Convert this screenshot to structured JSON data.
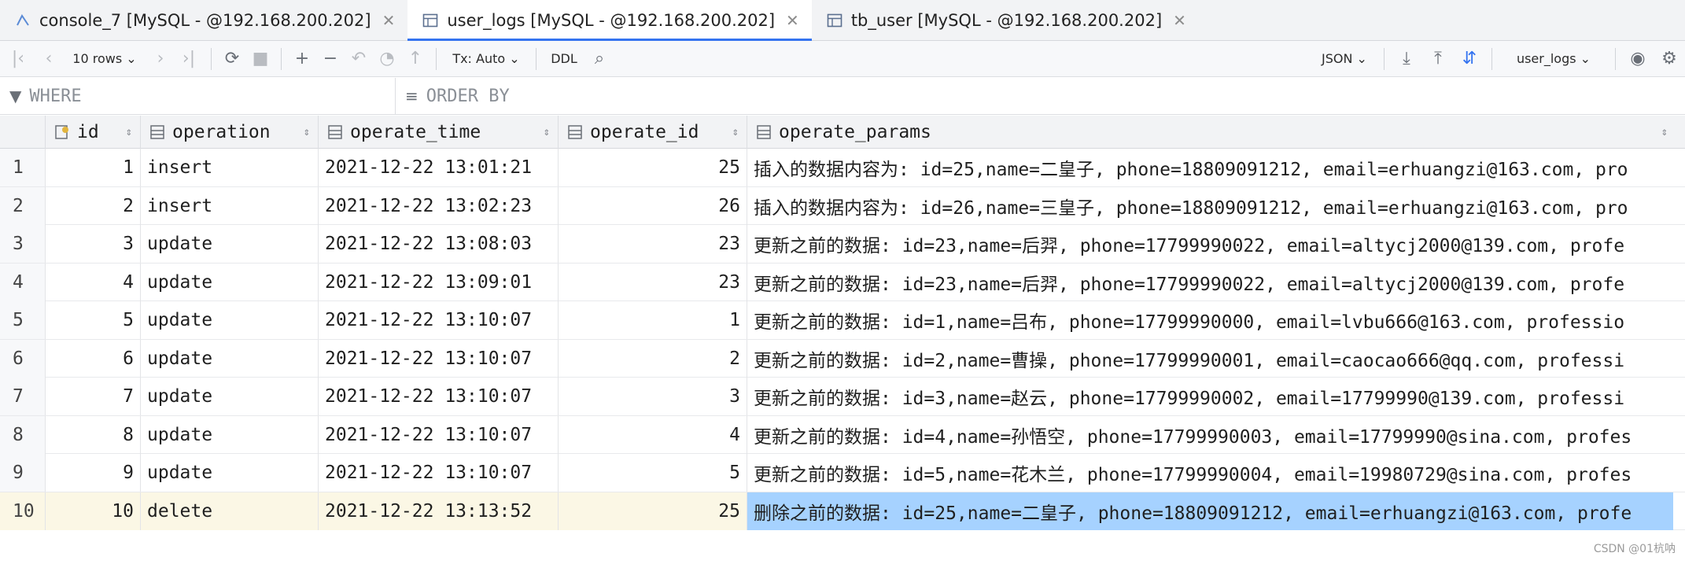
{
  "tabs": [
    {
      "label": "console_7 [MySQL - @192.168.200.202]",
      "icon": "console-icon",
      "active": false
    },
    {
      "label": "user_logs [MySQL - @192.168.200.202]",
      "icon": "table-icon",
      "active": true
    },
    {
      "label": "tb_user [MySQL - @192.168.200.202]",
      "icon": "table-icon",
      "active": false
    }
  ],
  "toolbar": {
    "rows_label": "10 rows",
    "tx_label": "Tx: Auto",
    "ddl_label": "DDL",
    "format_label": "JSON",
    "table_select": "user_logs"
  },
  "filter": {
    "where_placeholder": "WHERE",
    "orderby_placeholder": "ORDER BY"
  },
  "columns": [
    "id",
    "operation",
    "operate_time",
    "operate_id",
    "operate_params"
  ],
  "rows": [
    {
      "num": "1",
      "id": "1",
      "operation": "insert",
      "time": "2021-12-22 13:01:21",
      "opid": "25",
      "params": "插入的数据内容为: id=25,name=二皇子, phone=18809091212, email=erhuangzi@163.com, pro"
    },
    {
      "num": "2",
      "id": "2",
      "operation": "insert",
      "time": "2021-12-22 13:02:23",
      "opid": "26",
      "params": "插入的数据内容为: id=26,name=三皇子, phone=18809091212, email=erhuangzi@163.com, pro"
    },
    {
      "num": "3",
      "id": "3",
      "operation": "update",
      "time": "2021-12-22 13:08:03",
      "opid": "23",
      "params": "更新之前的数据: id=23,name=后羿, phone=17799990022, email=altycj2000@139.com, profe"
    },
    {
      "num": "4",
      "id": "4",
      "operation": "update",
      "time": "2021-12-22 13:09:01",
      "opid": "23",
      "params": "更新之前的数据: id=23,name=后羿, phone=17799990022, email=altycj2000@139.com, profe"
    },
    {
      "num": "5",
      "id": "5",
      "operation": "update",
      "time": "2021-12-22 13:10:07",
      "opid": "1",
      "params": "更新之前的数据: id=1,name=吕布, phone=17799990000, email=lvbu666@163.com, professio"
    },
    {
      "num": "6",
      "id": "6",
      "operation": "update",
      "time": "2021-12-22 13:10:07",
      "opid": "2",
      "params": "更新之前的数据: id=2,name=曹操, phone=17799990001, email=caocao666@qq.com, professi"
    },
    {
      "num": "7",
      "id": "7",
      "operation": "update",
      "time": "2021-12-22 13:10:07",
      "opid": "3",
      "params": "更新之前的数据: id=3,name=赵云, phone=17799990002, email=17799990@139.com, professi"
    },
    {
      "num": "8",
      "id": "8",
      "operation": "update",
      "time": "2021-12-22 13:10:07",
      "opid": "4",
      "params": "更新之前的数据: id=4,name=孙悟空, phone=17799990003, email=17799990@sina.com, profes"
    },
    {
      "num": "9",
      "id": "9",
      "operation": "update",
      "time": "2021-12-22 13:10:07",
      "opid": "5",
      "params": "更新之前的数据: id=5,name=花木兰, phone=17799990004, email=19980729@sina.com, profes"
    },
    {
      "num": "10",
      "id": "10",
      "operation": "delete",
      "time": "2021-12-22 13:13:52",
      "opid": "25",
      "params": "删除之前的数据: id=25,name=二皇子, phone=18809091212, email=erhuangzi@163.com, profe"
    }
  ],
  "selected_row": 10,
  "watermark": "CSDN @01杭呐",
  "colors": {
    "accent": "#3574f0",
    "selection": "#a6d2ff",
    "selected_row_bg": "#fbf7e5"
  }
}
